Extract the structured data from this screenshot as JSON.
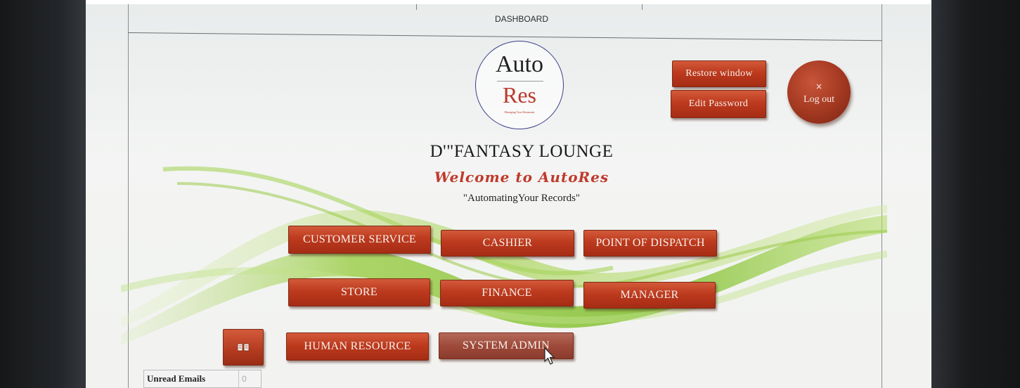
{
  "header": {
    "title": "DASHBOARD"
  },
  "logo": {
    "top_text": "Auto",
    "bottom_text": "Res",
    "tagline": "Managing Your Restaurant"
  },
  "company": {
    "name": "D'\"FANTASY LOUNGE",
    "welcome": "Welcome to AutoRes",
    "tagline": "\"AutomatingYour Records\""
  },
  "window_controls": {
    "restore_label": "Restore window",
    "edit_password_label": "Edit Password",
    "logout_icon": "×",
    "logout_label": "Log out"
  },
  "modules": {
    "customer_service": "CUSTOMER SERVICE",
    "cashier": "CASHIER",
    "point_of_dispatch": "POINT OF DISPATCH",
    "store": "STORE",
    "finance": "FINANCE",
    "manager": "MANAGER",
    "human_resource": "HUMAN RESOURCE",
    "system_admin": "SYSTEM ADMIN"
  },
  "icons": {
    "book": "book-icon"
  },
  "emails": {
    "label": "Unread Emails",
    "count": "0"
  },
  "colors": {
    "button": "#bd3a1e",
    "logo_red": "#b8392b",
    "welcome": "#c0392b",
    "wave_green": "#8fc43a"
  }
}
